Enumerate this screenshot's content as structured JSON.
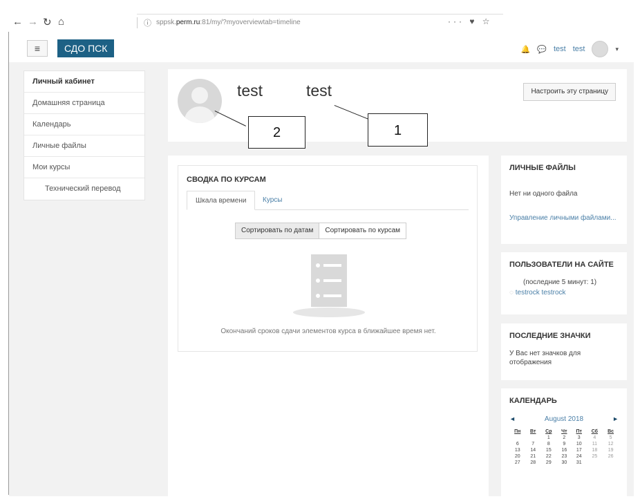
{
  "browser": {
    "back_glyph": "←",
    "forward_glyph": "→",
    "reload_glyph": "↻",
    "home_glyph": "⌂",
    "info_glyph": "ⓘ",
    "url_prefix": "sppsk.",
    "url_host": "perm.ru",
    "url_rest": ":81/my/?myoverviewtab=timeline",
    "actions": "··· ♥ ☆"
  },
  "navbar": {
    "menu_glyph": "≡",
    "brand": "СДО ПСК",
    "bell_glyph": "🔔",
    "chat_glyph": "💬",
    "user_first": "test",
    "user_last": "test",
    "caret": "▾"
  },
  "drawer": {
    "items": [
      "Личный кабинет",
      "Домашняя страница",
      "Календарь",
      "Личные файлы",
      "Мои курсы",
      "Технический перевод"
    ]
  },
  "header": {
    "first_name": "test",
    "last_name": "test",
    "customize_label": "Настроить эту страницу"
  },
  "annotations": {
    "label_1": "1",
    "label_2": "2"
  },
  "overview": {
    "title": "СВОДКА ПО КУРСАМ",
    "tab_timeline": "Шкала времени",
    "tab_courses": "Курсы",
    "sort_dates": "Сортировать по датам",
    "sort_courses": "Сортировать по курсам",
    "empty_text": "Окончаний сроков сдачи элементов курса в ближайшее время нет."
  },
  "blocks": {
    "files": {
      "title": "ЛИЧНЫЕ ФАЙЛЫ",
      "text": "Нет ни одного файла",
      "link": "Управление личными файлами..."
    },
    "online": {
      "title": "ПОЛЬЗОВАТЕЛИ НА САЙТЕ",
      "text": "(последние 5 минут: 1)",
      "user": "testrock testrock"
    },
    "badges": {
      "title": "ПОСЛЕДНИЕ ЗНАЧКИ",
      "text": "У Вас нет значков для отображения"
    },
    "calendar": {
      "title": "КАЛЕНДАРЬ",
      "prev": "◄",
      "next": "►",
      "month": "August 2018",
      "days": [
        "Пн",
        "Вт",
        "Ср",
        "Чт",
        "Пт",
        "Сб",
        "Вс"
      ],
      "weeks": [
        [
          "",
          "",
          "1",
          "2",
          "3",
          "4",
          "5"
        ],
        [
          "6",
          "7",
          "8",
          "9",
          "10",
          "11",
          "12"
        ],
        [
          "13",
          "14",
          "15",
          "16",
          "17",
          "18",
          "19"
        ],
        [
          "20",
          "21",
          "22",
          "23",
          "24",
          "25",
          "26"
        ],
        [
          "27",
          "28",
          "29",
          "30",
          "31",
          "",
          ""
        ]
      ]
    }
  }
}
